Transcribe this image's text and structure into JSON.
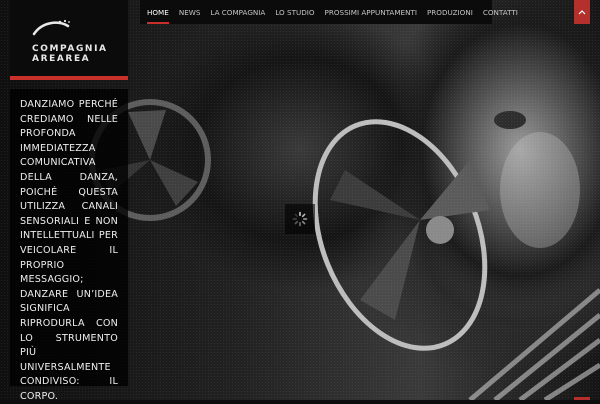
{
  "logo": {
    "name": "Compagnia Arearea",
    "line1": "COMPAGNIA",
    "line2": "AREAREA"
  },
  "nav": {
    "items": [
      {
        "label": "HOME",
        "active": true
      },
      {
        "label": "NEWS"
      },
      {
        "label": "LA COMPAGNIA"
      },
      {
        "label": "LO STUDIO"
      },
      {
        "label": "PROSSIMI APPUNTAMENTI"
      },
      {
        "label": "PRODUZIONI"
      },
      {
        "label": "CONTATTI"
      }
    ]
  },
  "manifesto": {
    "text": "DANZIAMO PERCHÉ CREDIAMO NELLE PROFONDA IMMEDIATEZZA COMUNICATIVA DELLA DANZA, POICHÉ QUESTA UTILIZZA CANALI SENSORIALI E NON INTELLETTUALI PER VEICOLARE IL PROPRIO MESSAGGIO; DANZARE UN’IDEA SIGNIFICA RIPRODURLA CON LO STRUMENTO PIÙ UNIVERSALMENTE CONDIVISO: IL CORPO."
  },
  "icons": {
    "top_toggle": "chevron-up-icon",
    "loader": "spinner-icon",
    "logo": "logo-mark"
  },
  "colors": {
    "accent": "#c9302c",
    "panel": "#0b0b0b",
    "nav_text": "#c4c4c4"
  }
}
